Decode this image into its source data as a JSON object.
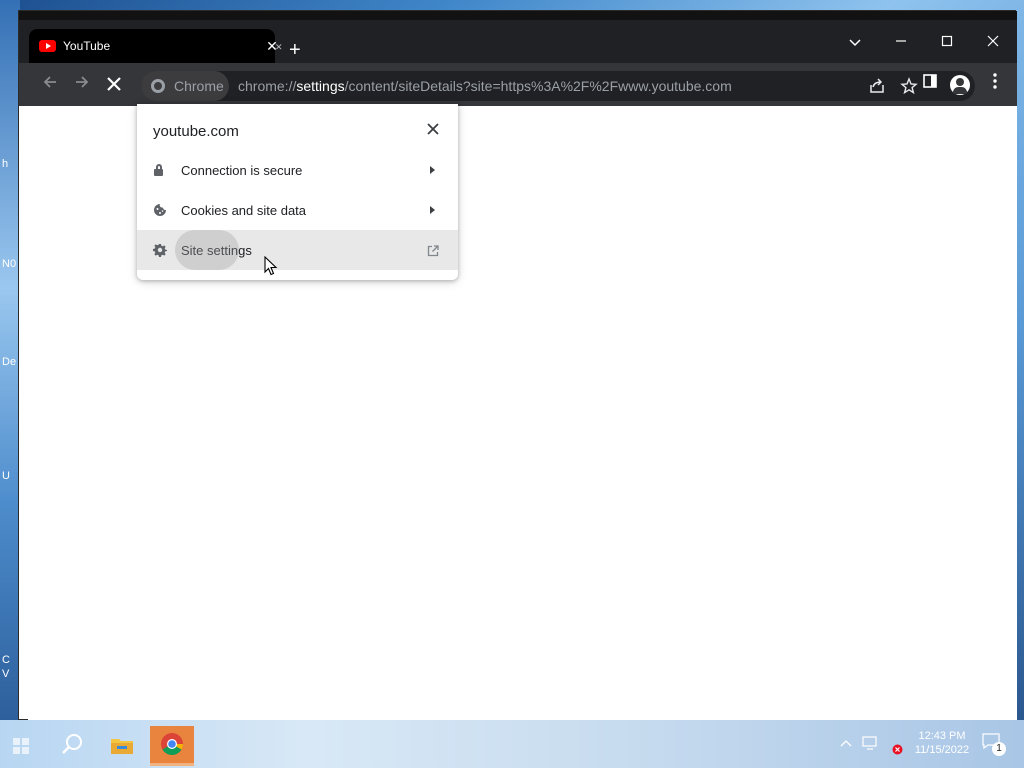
{
  "desktop": {
    "icon_fragments": [
      "h",
      "N0",
      "De",
      "U",
      "C",
      "V"
    ]
  },
  "browser": {
    "tab": {
      "title": "YouTube"
    },
    "omnibox": {
      "chip_label": "Chrome",
      "url_scheme": "chrome://",
      "url_host": "settings",
      "url_path": "/content/siteDetails?site=https%3A%2F%2Fwww.youtube.com"
    }
  },
  "site_info_popup": {
    "site": "youtube.com",
    "items": [
      {
        "label": "Connection is secure",
        "icon": "lock-icon",
        "trailing": "arrow"
      },
      {
        "label": "Cookies and site data",
        "icon": "cookie-icon",
        "trailing": "arrow"
      },
      {
        "label": "Site settings",
        "icon": "gear-icon",
        "trailing": "external-link",
        "hovered": true
      }
    ]
  },
  "taskbar": {
    "clock_time": "12:43 PM",
    "clock_date": "11/15/2022",
    "notification_count": "1"
  },
  "colors": {
    "titlebar": "#202124",
    "toolbar": "#35363a",
    "popup_hover": "#e8e8e9",
    "youtube_red": "#ff0000",
    "taskbar_active": "#e8843e"
  }
}
